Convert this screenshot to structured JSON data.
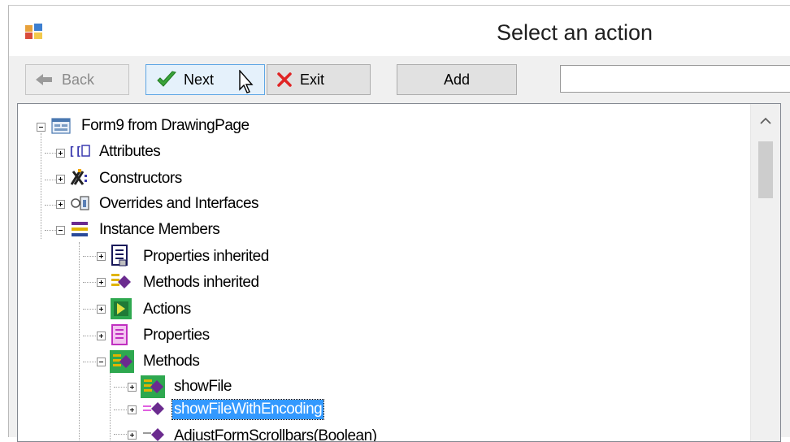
{
  "window": {
    "title": "Select an action",
    "app_icon": "form-app-icon"
  },
  "toolbar": {
    "back_label": "Back",
    "next_label": "Next",
    "exit_label": "Exit",
    "add_label": "Add",
    "search_value": ""
  },
  "tree": {
    "root": "Form9 from DrawingPage",
    "attributes": "Attributes",
    "constructors": "Constructors",
    "overrides": "Overrides and Interfaces",
    "instance_members": "Instance Members",
    "properties_inherited": "Properties inherited",
    "methods_inherited": "Methods inherited",
    "actions": "Actions",
    "properties": "Properties",
    "methods": "Methods",
    "show_file": "showFile",
    "show_file_with_encoding": "showFileWithEncoding",
    "adjust_form_scrollbars": "AdjustFormScrollbars(Boolean)"
  },
  "colors": {
    "selection": "#3399ff",
    "highlight_green": "#2ea84f",
    "methods_purple": "#6b2b8f"
  }
}
